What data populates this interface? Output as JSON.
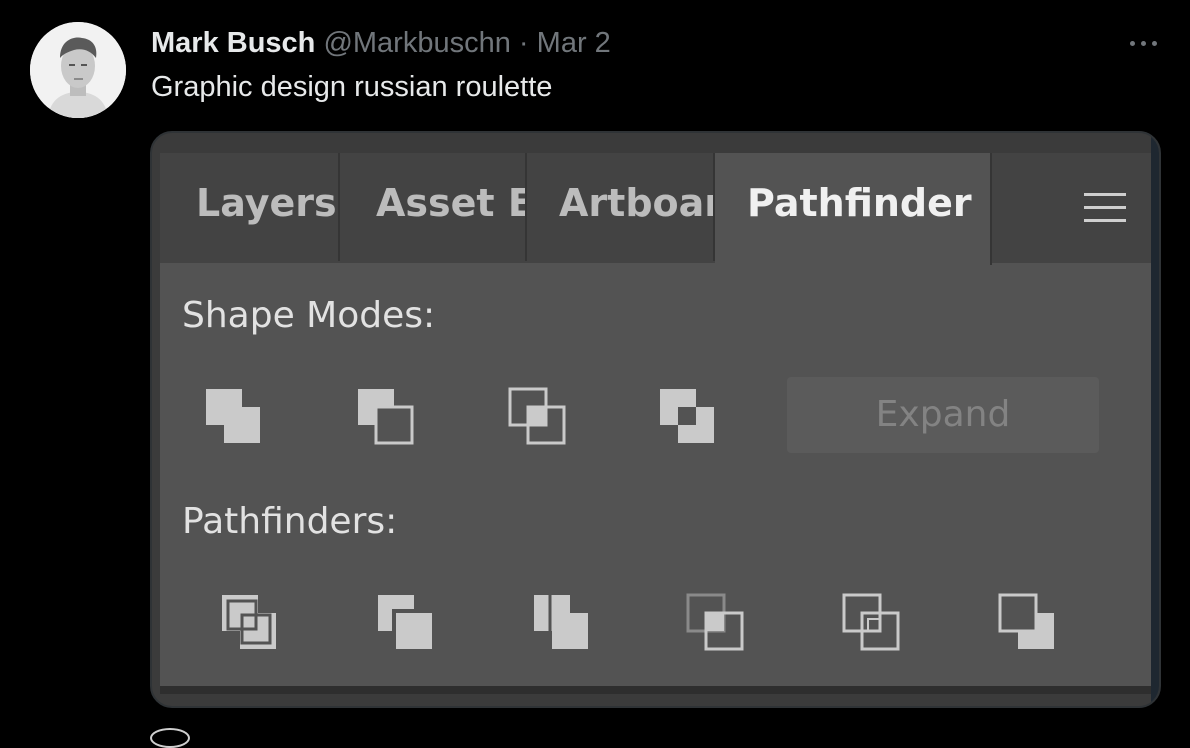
{
  "tweet": {
    "author_name": "Mark Busch",
    "handle": "@Markbuschn",
    "separator": "·",
    "date": "Mar 2",
    "text": "Graphic design russian roulette",
    "more_icon": "more-horizontal-icon"
  },
  "panel": {
    "tabs": [
      {
        "label": "Layers",
        "active": false
      },
      {
        "label": "Asset E",
        "active": false
      },
      {
        "label": "Artboar",
        "active": false
      },
      {
        "label": "Pathfinder",
        "active": true
      }
    ],
    "menu_icon": "hamburger-menu-icon",
    "shape_modes_label": "Shape Modes:",
    "shape_mode_buttons": [
      "unite-icon",
      "minus-front-icon",
      "intersect-icon",
      "exclude-icon"
    ],
    "expand_label": "Expand",
    "pathfinders_label": "Pathfinders:",
    "pathfinder_buttons": [
      "divide-icon",
      "trim-icon",
      "merge-icon",
      "crop-icon",
      "outline-icon",
      "minus-back-icon"
    ]
  },
  "colors": {
    "background": "#000000",
    "panel": "#535353",
    "tab_bar": "#434343",
    "icon": "#cacaca"
  }
}
